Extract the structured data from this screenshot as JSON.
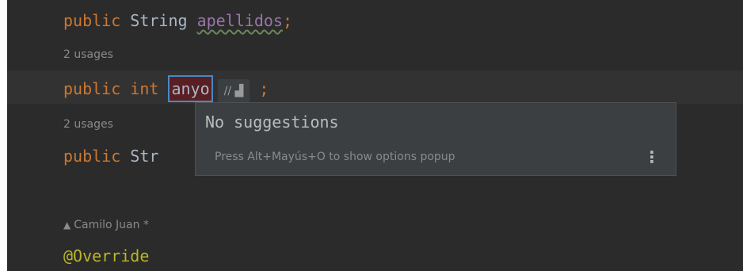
{
  "lines": [
    {
      "type": "code",
      "kw": "public",
      "type_name": "String",
      "field": "apellidos",
      "semi": ";"
    },
    {
      "type": "hint",
      "text": "2 usages"
    },
    {
      "type": "code",
      "kw": "public",
      "type_name": "int",
      "field": "anyo",
      "semi": ";"
    },
    {
      "type": "hint",
      "text": "2 usages"
    },
    {
      "type": "code",
      "kw": "public",
      "type_name_partial": "Str"
    },
    {
      "type": "author",
      "author": "Camilo Juan *"
    },
    {
      "type": "annotation",
      "text": "@Override"
    }
  ],
  "inlay": {
    "comment_icon": "//",
    "block_icon": "▟"
  },
  "popup": {
    "title": "No suggestions",
    "hint": "Press Alt+Mayús+O to show options popup",
    "menu_icon": "⋮"
  },
  "colors": {
    "background": "#2b2b2b",
    "keyword": "#cc7832",
    "field": "#9876aa",
    "text": "#a9b7c6",
    "rename_border": "#4a88c7",
    "rename_bg": "#5a1f22",
    "popup_bg": "#3c3f41"
  }
}
